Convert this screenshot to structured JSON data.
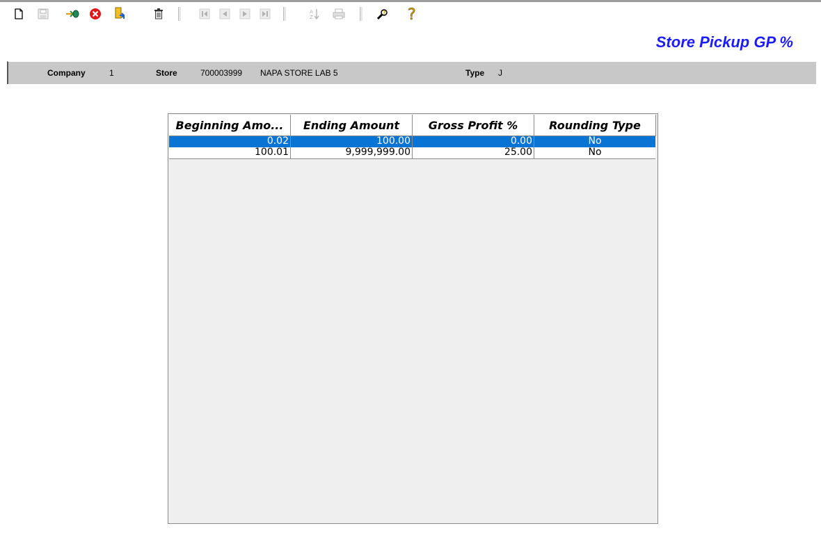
{
  "toolbar": {
    "buttons": [
      {
        "name": "new-icon"
      },
      {
        "name": "save-icon"
      },
      {
        "name": "enter-icon"
      },
      {
        "name": "cancel-icon"
      },
      {
        "name": "edit-document-icon"
      },
      {
        "name": "delete-icon"
      },
      {
        "name": "first-record-icon"
      },
      {
        "name": "previous-record-icon"
      },
      {
        "name": "next-record-icon"
      },
      {
        "name": "last-record-icon"
      },
      {
        "name": "sort-icon"
      },
      {
        "name": "print-icon"
      },
      {
        "name": "lookup-icon"
      },
      {
        "name": "help-icon"
      }
    ]
  },
  "page": {
    "title": "Store Pickup GP %"
  },
  "info": {
    "company_label": "Company",
    "company_value": "1",
    "store_label": "Store",
    "store_value": "700003999",
    "store_name": "NAPA STORE LAB 5",
    "type_label": "Type",
    "type_value": "J"
  },
  "grid": {
    "columns": [
      "Beginning Amo...",
      "Ending Amount",
      "Gross Profit %",
      "Rounding Type"
    ],
    "rows": [
      {
        "begin": "0.02",
        "end": "100.00",
        "gp": "0.00",
        "rounding": "No",
        "selected": true
      },
      {
        "begin": "100.01",
        "end": "9,999,999.00",
        "gp": "25.00",
        "rounding": "No",
        "selected": false
      }
    ]
  },
  "colors": {
    "title": "#1c1cff",
    "selection": "#0a74d4",
    "info_bar": "#c8c8c8"
  }
}
